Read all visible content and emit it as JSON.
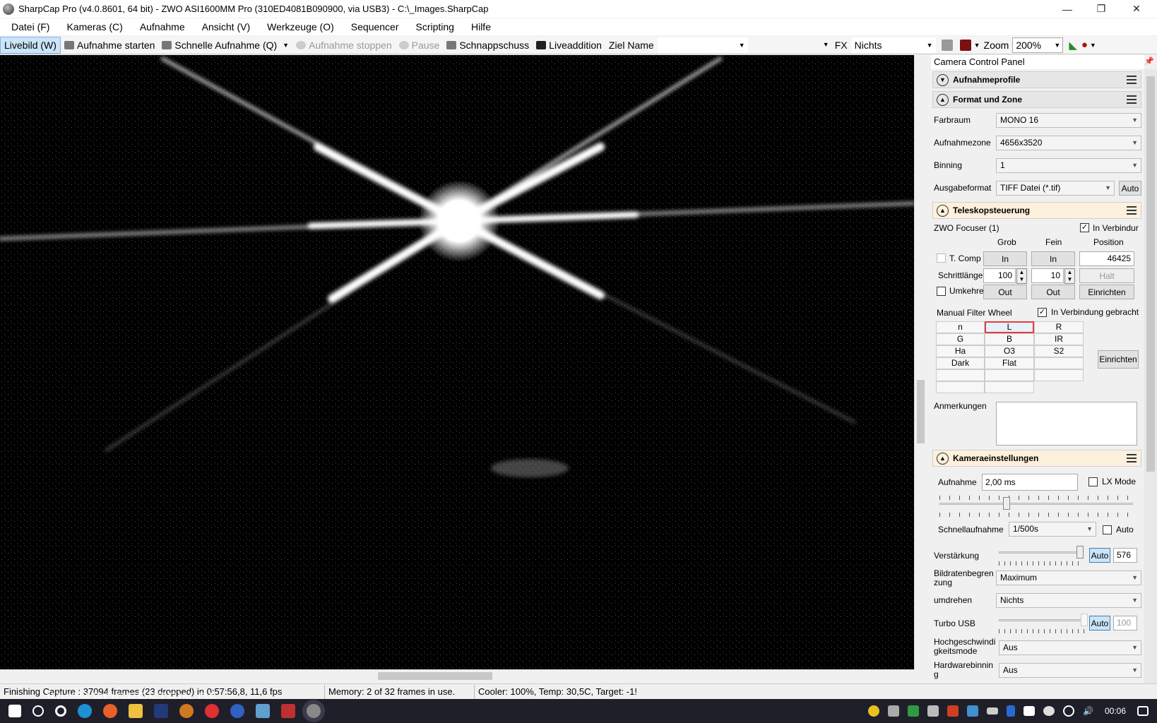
{
  "window": {
    "title": "SharpCap Pro (v4.0.8601, 64 bit) - ZWO ASI1600MM Pro (310ED4081B090900, via USB3) - C:\\_Images.SharpCap",
    "min": "—",
    "restore": "❐",
    "close": "✕"
  },
  "menu": [
    "Datei (F)",
    "Kameras (C)",
    "Aufnahme",
    "Ansicht (V)",
    "Werkzeuge (O)",
    "Sequencer",
    "Scripting",
    "Hilfe"
  ],
  "toolbar": {
    "livebild": "Livebild (W)",
    "start": "Aufnahme starten",
    "schnell": "Schnelle Aufnahme (Q)",
    "stop": "Aufnahme stoppen",
    "pause": "Pause",
    "snapshot": "Schnappschuss",
    "liveadd": "Liveaddition",
    "ziel": "Ziel Name",
    "fx": "FX",
    "fx_value": "Nichts",
    "zoom": "Zoom",
    "zoom_value": "200%"
  },
  "panel": {
    "title": "Camera Control Panel",
    "profiles": "Aufnahmeprofile",
    "format": {
      "title": "Format und Zone",
      "farbraum_l": "Farbraum",
      "farbraum": "MONO 16",
      "zone_l": "Aufnahmezone",
      "zone": "4656x3520",
      "binning_l": "Binning",
      "binning": "1",
      "ausgabe_l": "Ausgabeformat",
      "ausgabe": "TIFF Datei (*.tif)",
      "auto": "Auto"
    },
    "tele": {
      "title": "Teleskopsteuerung",
      "focuser": "ZWO Focuser (1)",
      "connected": "In Verbindur",
      "grob": "Grob",
      "fein": "Fein",
      "position": "Position",
      "tcomp": "T. Comp",
      "in": "In",
      "pos_value": "46425",
      "schritt": "Schrittlänge",
      "grob_step": "100",
      "fein_step": "10",
      "halt": "Halt",
      "umkehr": "Umkehre",
      "out": "Out",
      "einrichten": "Einrichten"
    },
    "filter": {
      "name": "Manual Filter Wheel",
      "connected": "In Verbindung gebracht",
      "cells": [
        [
          "n",
          "L",
          "R"
        ],
        [
          "G",
          "B",
          "IR"
        ],
        [
          "Ha",
          "O3",
          "S2"
        ],
        [
          "Dark",
          "Flat",
          ""
        ],
        [
          "",
          "",
          ""
        ],
        [
          "",
          "",
          ""
        ]
      ],
      "einrichten": "Einrichten",
      "notes": "Anmerkungen"
    },
    "cam": {
      "title": "Kameraeinstellungen",
      "aufnahme_l": "Aufnahme",
      "aufnahme": "2,00 ms",
      "lx": "LX Mode",
      "schnell_l": "Schnellaufnahme",
      "schnell": "1/500s",
      "auto": "Auto",
      "gain_l": "Verstärkung",
      "gain": "576",
      "fps_l": "Bildratenbegren zung",
      "fps": "Maximum",
      "flip_l": "umdrehen",
      "flip": "Nichts",
      "turbo_l": "Turbo USB",
      "turbo": "100",
      "hs_l": "Hochgeschwindi gkeitsmode",
      "hs": "Aus",
      "hw_l": "Hardwarebinnin g",
      "hw": "Aus"
    }
  },
  "status": {
    "capture": "Finishing Capture : 37094 frames (23 dropped) in 0:57:56,8, 11,6 fps",
    "memory": "Memory: 2 of 32 frames in use.",
    "cooler": "Cooler: 100%, Temp: 30,5C, Target: -1!",
    "watermark": "WWW.ROGERSTEIN.DE"
  },
  "taskbar": {
    "time": "00:06"
  },
  "colors": {
    "accent": "#0078d7",
    "selected": "#cce4f7",
    "warm": "#fdf0dc"
  }
}
